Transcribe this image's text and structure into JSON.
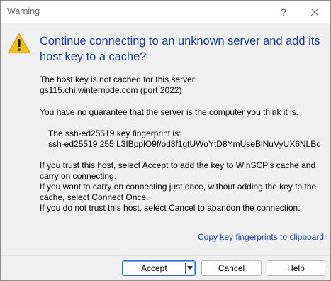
{
  "window": {
    "title": "Warning",
    "help_glyph": "?",
    "close_icon": "close-icon"
  },
  "dialog": {
    "icon": "warning-icon",
    "heading_line1": "Continue connecting to an unknown server and add its",
    "heading_line2": "host key to a cache?",
    "lines": {
      "l1": "The host key is not cached for this server:",
      "l2": "gs115.chi.winternode.com (port 2022)",
      "l3": "You have no guarantee that the server is the computer you think it is.",
      "fp_label": "The ssh-ed25519 key fingerprint is:",
      "fp_value": "ssh-ed25519 255 L3IBpplO9f/od8f1gtUWoYtD8YmUseBlNuVyUX6NLBc",
      "l4": "If you trust this host, select Accept to add the key to WinSCP's cache and",
      "l5": "carry on connecting.",
      "l6": "If you want to carry on connecting just once, without adding the key to the",
      "l7": "cache, select Connect Once.",
      "l8": "If you do not trust this host, select Cancel to abandon the connection."
    },
    "copy_link": "Copy key fingerprints to clipboard"
  },
  "buttons": {
    "accept": "Accept",
    "cancel": "Cancel",
    "help": "Help"
  },
  "colors": {
    "heading": "#1b3e93",
    "link": "#1a3fa0",
    "warning_fill": "#f2c01e",
    "default_button_border": "#2f6ad3"
  }
}
